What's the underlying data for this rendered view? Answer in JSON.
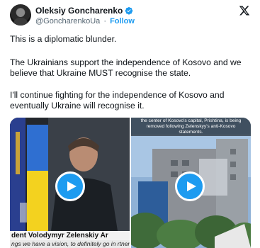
{
  "author": {
    "name": "Oleksiy Goncharenko",
    "handle": "@GoncharenkoUa",
    "separator": "·",
    "follow_label": "Follow"
  },
  "tweet": {
    "paragraphs": [
      "This is a diplomatic blunder.",
      "The Ukrainians support the independence of Kosovo and we believe that Ukraine MUST recognise the state.",
      "I'll continue fighting for the independence of Kosovo and eventually Ukraine will recognise it."
    ]
  },
  "media": {
    "left_video": {
      "subtitle_line1": "dent Volodymyr Zelenskiy Ar",
      "subtitle_line2": "ngs we have a vision, to definitely go in rtnership. This very important."
    },
    "right_video": {
      "caption": "the center of Kosovo's capital, Prishtina, is being removed following Zelenskyy's anti-Kosovo statements."
    }
  },
  "colors": {
    "accent": "#1d9bf0",
    "text": "#0f1419",
    "secondary": "#536471"
  },
  "icons": [
    "avatar",
    "verified-badge-icon",
    "x-logo-icon",
    "play-icon"
  ]
}
